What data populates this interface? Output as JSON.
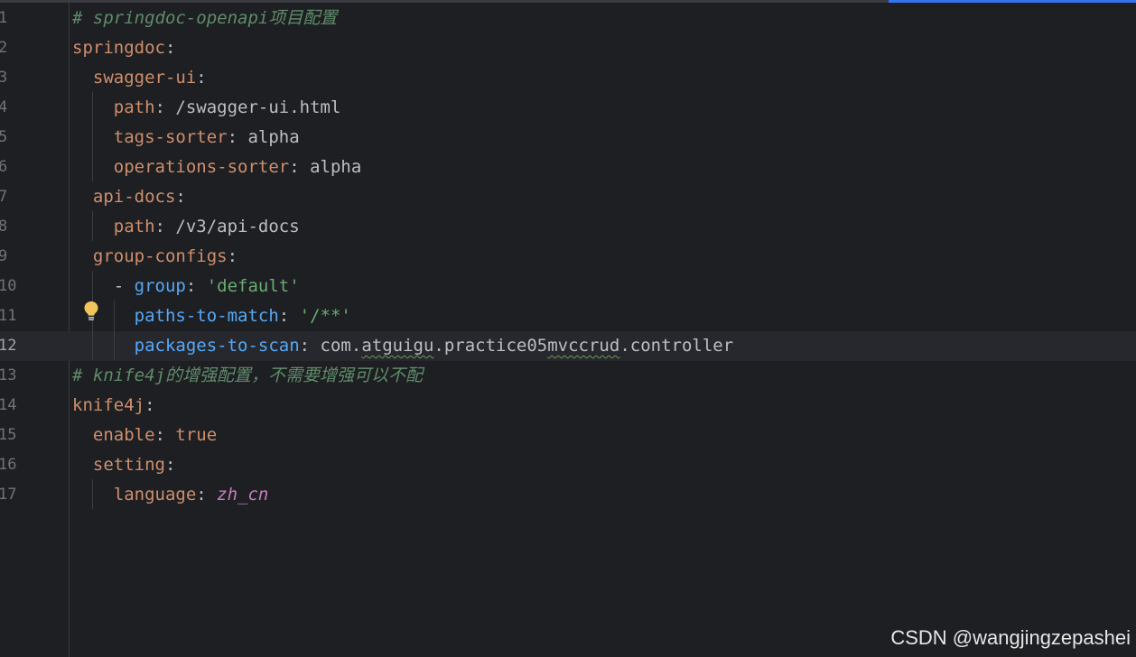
{
  "editor": {
    "active_line": 12,
    "lines": [
      {
        "num": "1",
        "parts": [
          {
            "t": "# springdoc-openapi项目配置",
            "c": "c-comment-green"
          }
        ]
      },
      {
        "num": "2",
        "parts": [
          {
            "t": "springdoc",
            "c": "c-key"
          },
          {
            "t": ":",
            "c": "c-punct"
          }
        ]
      },
      {
        "num": "3",
        "parts": [
          {
            "t": "  swagger-ui",
            "c": "c-key"
          },
          {
            "t": ":",
            "c": "c-punct"
          }
        ]
      },
      {
        "num": "4",
        "parts": [
          {
            "t": "    path",
            "c": "c-key"
          },
          {
            "t": ": /swagger-ui.html",
            "c": "c-val"
          }
        ]
      },
      {
        "num": "5",
        "parts": [
          {
            "t": "    tags-sorter",
            "c": "c-key"
          },
          {
            "t": ": alpha",
            "c": "c-val"
          }
        ]
      },
      {
        "num": "6",
        "parts": [
          {
            "t": "    operations-sorter",
            "c": "c-key"
          },
          {
            "t": ": alpha",
            "c": "c-val"
          }
        ]
      },
      {
        "num": "7",
        "parts": [
          {
            "t": "  api-docs",
            "c": "c-key"
          },
          {
            "t": ":",
            "c": "c-punct"
          }
        ]
      },
      {
        "num": "8",
        "parts": [
          {
            "t": "    path",
            "c": "c-key"
          },
          {
            "t": ": /v3/api-docs",
            "c": "c-val"
          }
        ]
      },
      {
        "num": "9",
        "parts": [
          {
            "t": "  group-configs",
            "c": "c-key"
          },
          {
            "t": ":",
            "c": "c-punct"
          }
        ]
      },
      {
        "num": "10",
        "parts": [
          {
            "t": "    - ",
            "c": "c-punct"
          },
          {
            "t": "group",
            "c": "c-key-blue"
          },
          {
            "t": ": ",
            "c": "c-punct"
          },
          {
            "t": "'default'",
            "c": "c-str"
          }
        ]
      },
      {
        "num": "11",
        "parts": [
          {
            "t": "      paths-to-match",
            "c": "c-key-blue"
          },
          {
            "t": ": ",
            "c": "c-punct"
          },
          {
            "t": "'/**'",
            "c": "c-str"
          }
        ]
      },
      {
        "num": "12",
        "parts": [
          {
            "t": "      packages-to-scan",
            "c": "c-key-blue"
          },
          {
            "t": ": com.",
            "c": "c-val"
          },
          {
            "t": "atguigu",
            "c": "c-val squiggle"
          },
          {
            "t": ".practice05",
            "c": "c-val"
          },
          {
            "t": "mvccrud",
            "c": "c-val squiggle"
          },
          {
            "t": ".controller",
            "c": "c-val"
          }
        ]
      },
      {
        "num": "13",
        "parts": [
          {
            "t": "# knife4j的增强配置，不需要增强可以不配",
            "c": "c-comment-green"
          }
        ]
      },
      {
        "num": "14",
        "parts": [
          {
            "t": "knife4j",
            "c": "c-key"
          },
          {
            "t": ":",
            "c": "c-punct"
          }
        ]
      },
      {
        "num": "15",
        "parts": [
          {
            "t": "  enable",
            "c": "c-key"
          },
          {
            "t": ": ",
            "c": "c-punct"
          },
          {
            "t": "true",
            "c": "c-true"
          }
        ]
      },
      {
        "num": "16",
        "parts": [
          {
            "t": "  setting",
            "c": "c-key"
          },
          {
            "t": ":",
            "c": "c-punct"
          }
        ]
      },
      {
        "num": "17",
        "parts": [
          {
            "t": "    language",
            "c": "c-key"
          },
          {
            "t": ": ",
            "c": "c-punct"
          },
          {
            "t": "zh_cn",
            "c": "c-enum"
          }
        ]
      }
    ]
  },
  "icons": {
    "intention": "lightbulb-icon"
  },
  "colors": {
    "background": "#1e1f22",
    "current_line": "#26282e",
    "key": "#cf8e6d",
    "key_blue": "#56a8f5",
    "string": "#6aab73",
    "comment": "#5f8c6b",
    "enum": "#c77dbb",
    "accent": "#3574f0"
  },
  "watermark": "CSDN @wangjingzepashei"
}
